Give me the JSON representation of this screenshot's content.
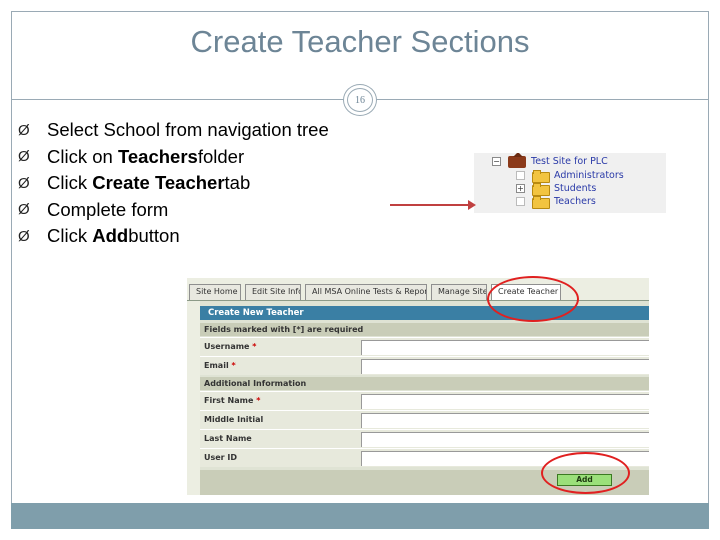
{
  "slide": {
    "title": "Create Teacher Sections",
    "page_number": "16"
  },
  "bullets": [
    {
      "pre": "Select School from navigation tree",
      "bold": "",
      "post": ""
    },
    {
      "pre": "Click on ",
      "bold": "Teachers",
      "post": " folder"
    },
    {
      "pre": "Click ",
      "bold": "Create Teacher",
      "post": " tab"
    },
    {
      "pre": "Complete form",
      "bold": "",
      "post": ""
    },
    {
      "pre": "Click ",
      "bold": "Add",
      "post": " button"
    }
  ],
  "bullet_glyph": "Ø",
  "tree": {
    "root": "Test Site for PLC",
    "items": [
      "Administrators",
      "Students",
      "Teachers"
    ],
    "toggles": {
      "root": "−",
      "students": "+"
    }
  },
  "form": {
    "tabs": [
      "Site Home",
      "Edit Site Info",
      "All MSA Online Tests & Reports",
      "Manage Site",
      "Create Teacher"
    ],
    "header": "Create New Teacher",
    "required_note": "Fields marked with [*] are required",
    "additional_section": "Additional Information",
    "fields_top": [
      {
        "label": "Username",
        "required": "*"
      },
      {
        "label": "Email",
        "required": "*"
      }
    ],
    "fields_bottom": [
      {
        "label": "First Name",
        "required": "*"
      },
      {
        "label": "Middle Initial",
        "required": ""
      },
      {
        "label": "Last Name",
        "required": ""
      },
      {
        "label": "User ID",
        "required": ""
      }
    ],
    "add_label": "Add"
  },
  "colors": {
    "title": "#6d8596",
    "accent_bar": "#7f9eab",
    "highlight_circle": "#e02020",
    "form_header": "#3a7fa4",
    "add_button": "#9be07a"
  }
}
